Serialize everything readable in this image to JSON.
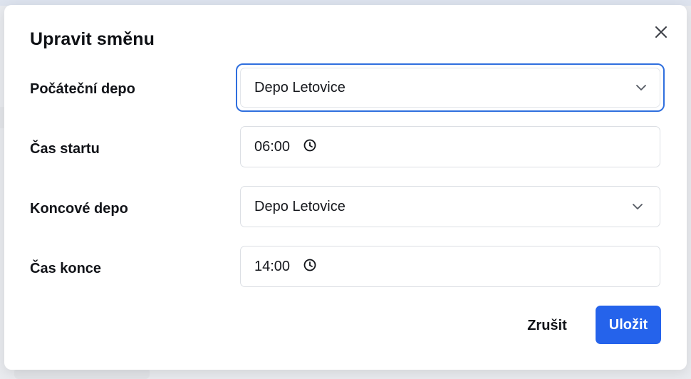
{
  "dialog": {
    "title": "Upravit směnu",
    "close_icon": "close-icon"
  },
  "form": {
    "start_depot": {
      "label": "Počáteční depo",
      "value": "Depo Letovice",
      "icon": "chevron-down-icon",
      "focused": true
    },
    "start_time": {
      "label": "Čas startu",
      "value": "06:00",
      "icon": "clock-icon"
    },
    "end_depot": {
      "label": "Koncové depo",
      "value": "Depo Letovice",
      "icon": "chevron-down-icon"
    },
    "end_time": {
      "label": "Čas konce",
      "value": "14:00",
      "icon": "clock-icon"
    }
  },
  "actions": {
    "cancel_label": "Zrušit",
    "save_label": "Uložit"
  },
  "colors": {
    "accent": "#2563eb",
    "focus_ring": "#2f6fde",
    "text": "#111318",
    "border": "#dcdfe4"
  }
}
